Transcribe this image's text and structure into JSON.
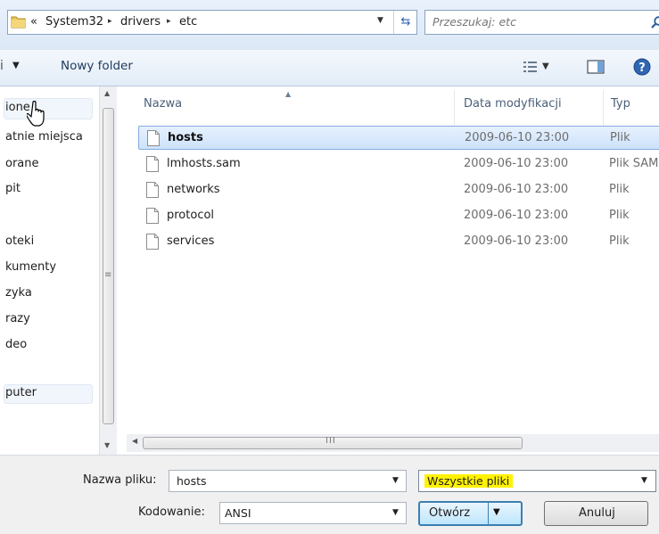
{
  "address": {
    "overflow": "«",
    "crumbs": [
      "System32",
      "drivers",
      "etc"
    ],
    "separator": "▸",
    "dropdown": "▼",
    "refresh": "⇆"
  },
  "search": {
    "placeholder": "Przeszukaj: etc"
  },
  "commandbar": {
    "new_folder": "Nowy folder",
    "arrow": "▼"
  },
  "nav": {
    "items": [
      "ione",
      "atnie miejsca",
      "orane",
      "pit",
      "oteki",
      "kumenty",
      "zyka",
      "razy",
      "deo",
      "puter"
    ]
  },
  "columns": {
    "name": "Nazwa",
    "date": "Data modyfikacji",
    "type": "Typ"
  },
  "files": [
    {
      "name": "hosts",
      "date": "2009-06-10 23:00",
      "type": "Plik",
      "selected": true
    },
    {
      "name": "lmhosts.sam",
      "date": "2009-06-10 23:00",
      "type": "Plik SAM"
    },
    {
      "name": "networks",
      "date": "2009-06-10 23:00",
      "type": "Plik"
    },
    {
      "name": "protocol",
      "date": "2009-06-10 23:00",
      "type": "Plik"
    },
    {
      "name": "services",
      "date": "2009-06-10 23:00",
      "type": "Plik"
    }
  ],
  "bottom": {
    "filename_label": "Nazwa pliku:",
    "filename_value": "hosts",
    "filetype_value": "Wszystkie pliki",
    "encoding_label": "Kodowanie:",
    "encoding_value": "ANSI",
    "open_button": "Otwórz",
    "cancel_button": "Anuluj"
  },
  "colors": {
    "highlight": "#fff200",
    "selection": "#cce2fb",
    "accent": "#3c7fb1"
  }
}
